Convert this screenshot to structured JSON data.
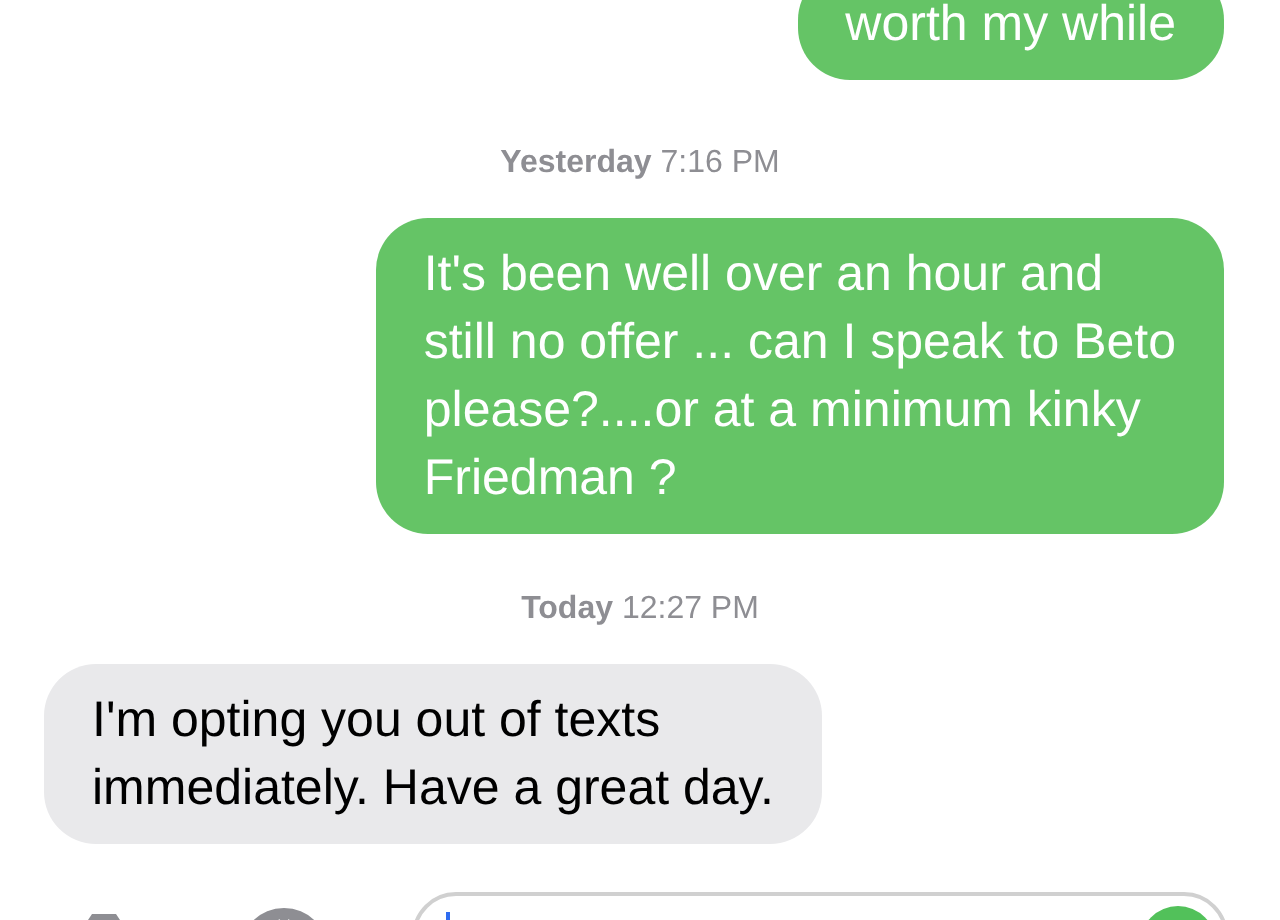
{
  "messages": [
    {
      "kind": "sent",
      "text": "worth my while"
    },
    {
      "kind": "timestamp",
      "text": "**Yesterday** 7:16 PM"
    },
    {
      "kind": "sent",
      "text": "It's been well over an hour and\nstill no offer ... can I speak to Beto\nplease?....or at a minimum kinky\nFriedman ?"
    },
    {
      "kind": "timestamp",
      "text": "**Today** 12:27 PM"
    },
    {
      "kind": "received",
      "text": "I'm opting you out of texts\nimmediately. Have a great day."
    }
  ]
}
